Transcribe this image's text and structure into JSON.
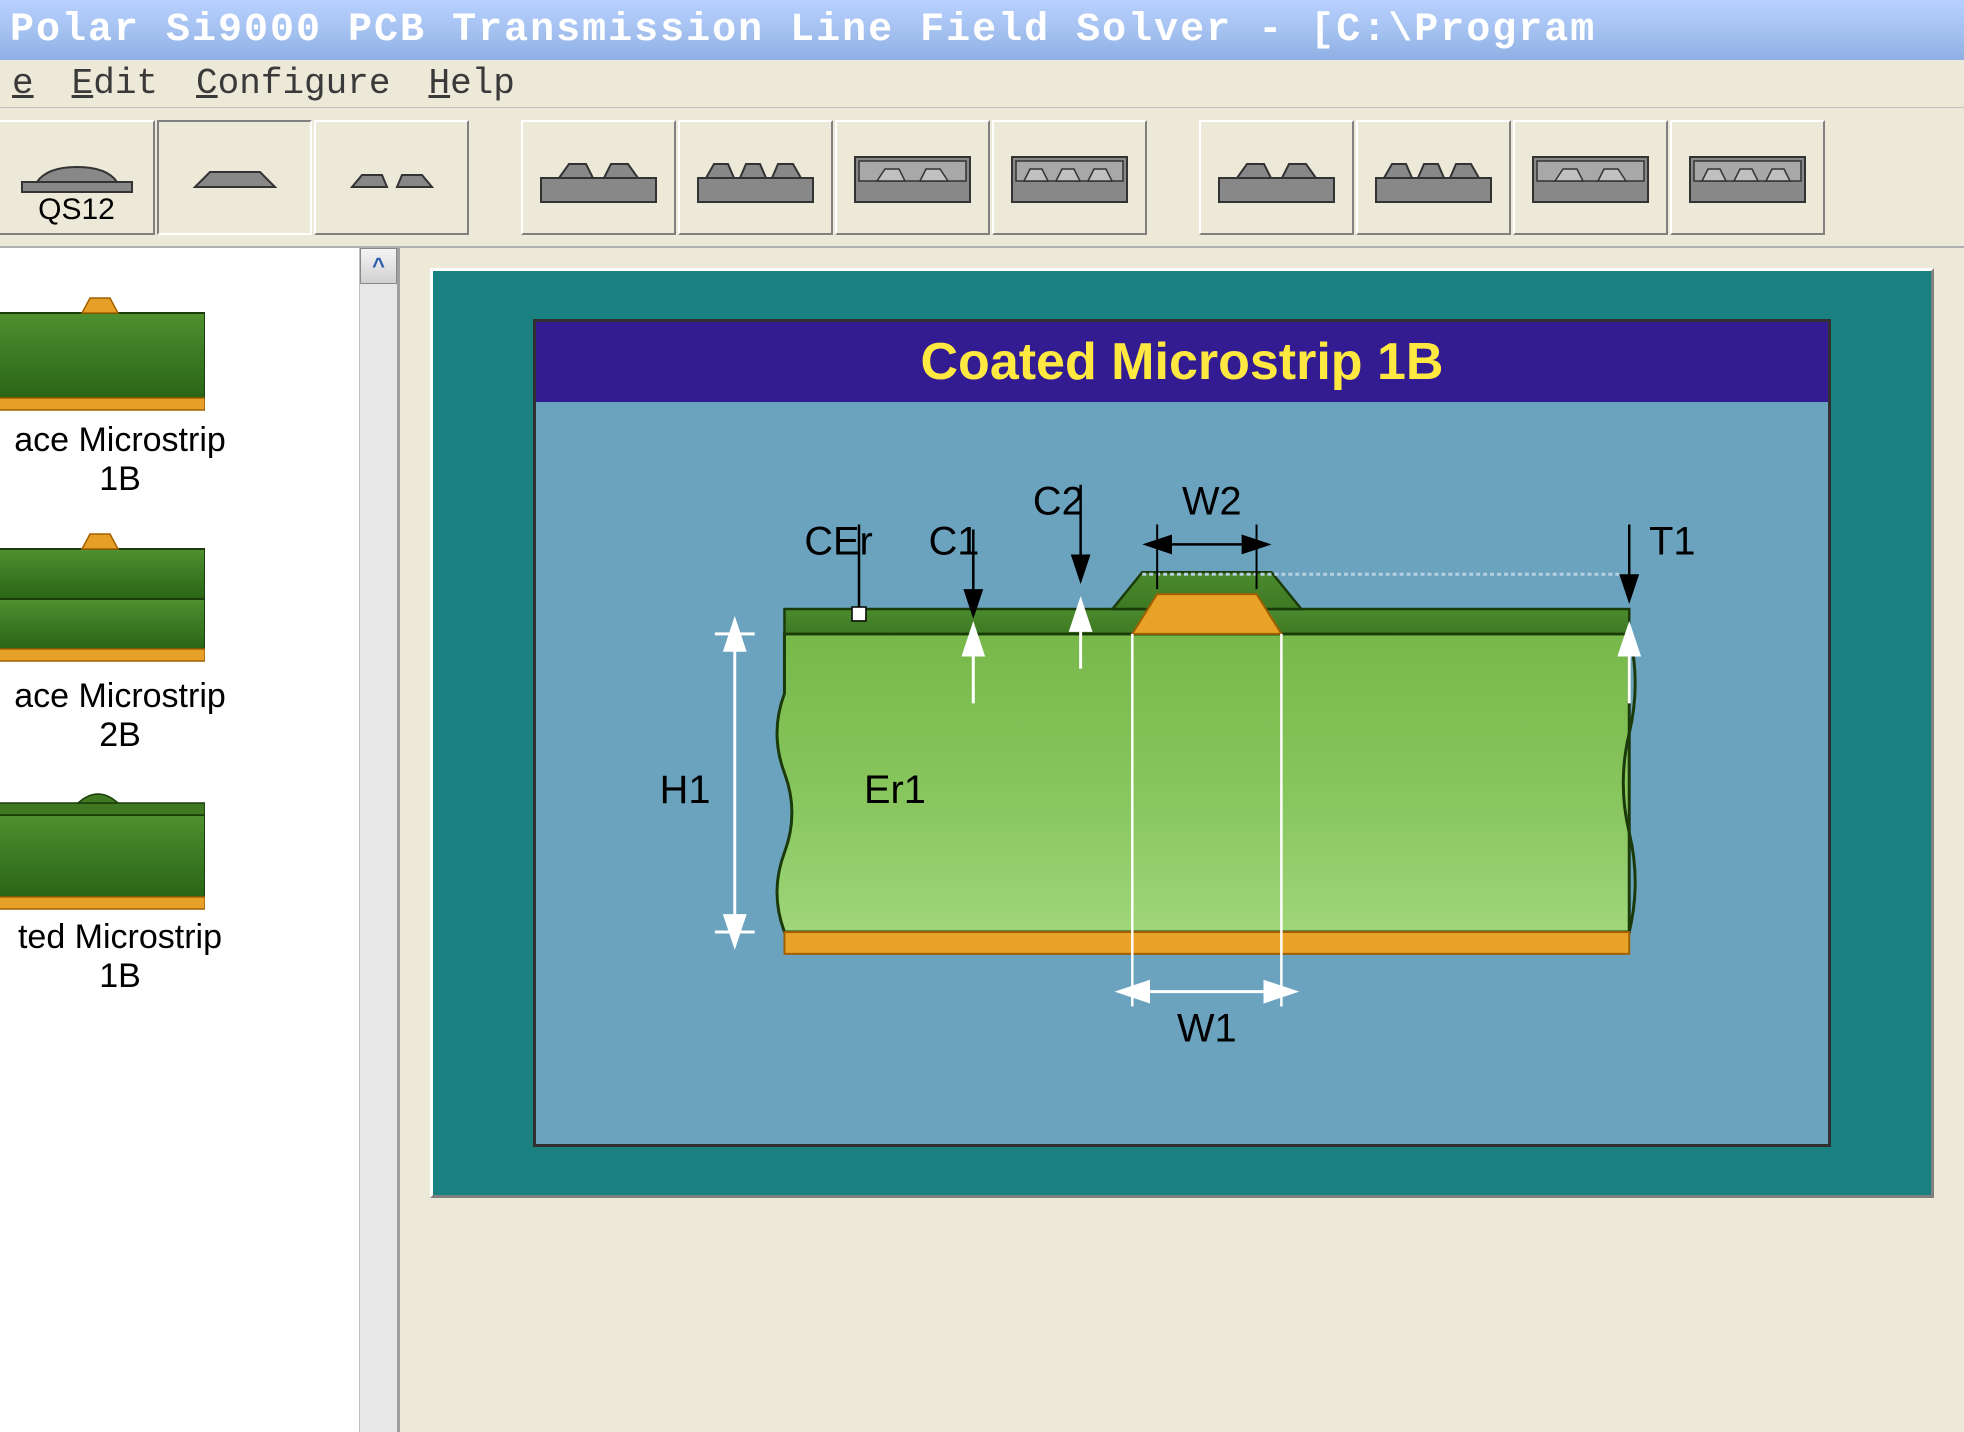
{
  "window": {
    "title": "Polar Si9000 PCB Transmission Line Field Solver - [C:\\Program"
  },
  "menu": {
    "file_fragment": "e",
    "edit": "Edit",
    "configure": "Configure",
    "help": "Help"
  },
  "toolbar": {
    "qs12_label": "QS12"
  },
  "sidebar": {
    "items": [
      {
        "label": "ace Microstrip 1B"
      },
      {
        "label": "ace Microstrip 2B"
      },
      {
        "label": "ted Microstrip 1B"
      }
    ]
  },
  "diagram": {
    "title": "Coated Microstrip 1B",
    "labels": {
      "CEr": "CEr",
      "C1": "C1",
      "C2": "C2",
      "W2": "W2",
      "T1": "T1",
      "H1": "H1",
      "Er1": "Er1",
      "W1": "W1"
    }
  }
}
